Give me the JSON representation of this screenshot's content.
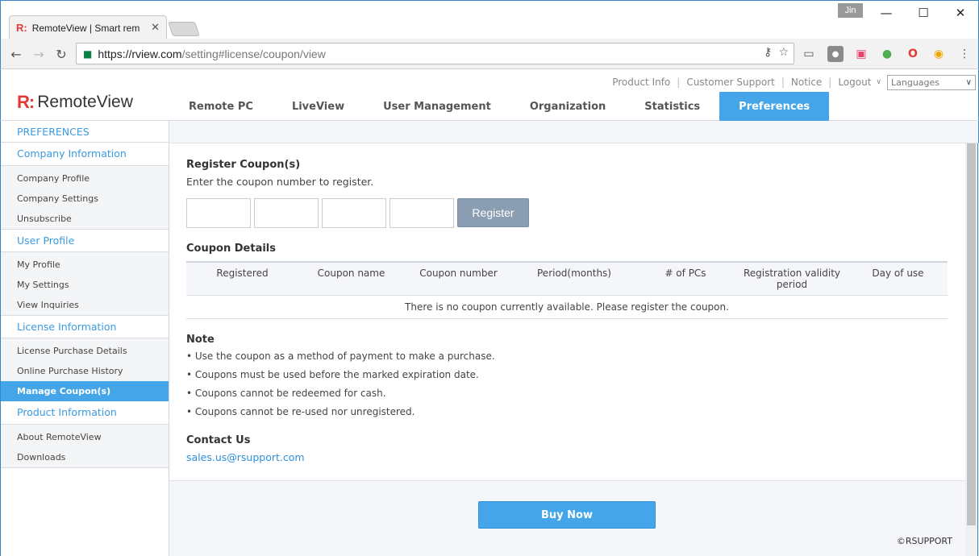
{
  "browser": {
    "tab_title": "RemoteView | Smart rem",
    "tab_favicon": "R:",
    "user_badge": "Jin",
    "url_host": "https://rview.com",
    "url_path": "/setting#license/coupon/view"
  },
  "header": {
    "logo_mark": "R:",
    "logo_text": "RemoteView",
    "top_links": [
      "Product Info",
      "Customer Support",
      "Notice",
      "Logout"
    ],
    "language_placeholder": "Languages",
    "nav": [
      {
        "label": "Remote PC",
        "active": false
      },
      {
        "label": "LiveView",
        "active": false
      },
      {
        "label": "User Management",
        "active": false
      },
      {
        "label": "Organization",
        "active": false
      },
      {
        "label": "Statistics",
        "active": false
      },
      {
        "label": "Preferences",
        "active": true
      }
    ]
  },
  "sidebar": {
    "title": "PREFERENCES",
    "sections": [
      {
        "label": "Company Information",
        "items": [
          "Company Profile",
          "Company Settings",
          "Unsubscribe"
        ]
      },
      {
        "label": "User Profile",
        "items": [
          "My Profile",
          "My Settings",
          "View Inquiries"
        ]
      },
      {
        "label": "License Information",
        "items": [
          "License Purchase Details",
          "Online Purchase History",
          "Manage Coupon(s)"
        ]
      },
      {
        "label": "Product Information",
        "items": [
          "About RemoteView",
          "Downloads"
        ]
      }
    ],
    "active_item": "Manage Coupon(s)"
  },
  "main": {
    "register_title": "Register Coupon(s)",
    "register_desc": "Enter the coupon number to register.",
    "register_button": "Register",
    "details_title": "Coupon Details",
    "columns": [
      "Registered",
      "Coupon name",
      "Coupon number",
      "Period(months)",
      "# of PCs",
      "Registration validity period",
      "Day of use"
    ],
    "empty_message": "There is no coupon currently available. Please register the coupon.",
    "note_title": "Note",
    "notes": [
      "• Use the coupon as a method of payment to make a purchase.",
      "• Coupons must be used before the marked expiration date.",
      "• Coupons cannot be redeemed for cash.",
      "• Coupons cannot be re-used nor unregistered."
    ],
    "contact_title": "Contact Us",
    "contact_email": "sales.us@rsupport.com",
    "buy_button": "Buy Now",
    "copyright": "©RSUPPORT"
  },
  "colors": {
    "accent": "#44a5e8",
    "logo_red": "#e53935",
    "register_button": "#8b9db1"
  }
}
